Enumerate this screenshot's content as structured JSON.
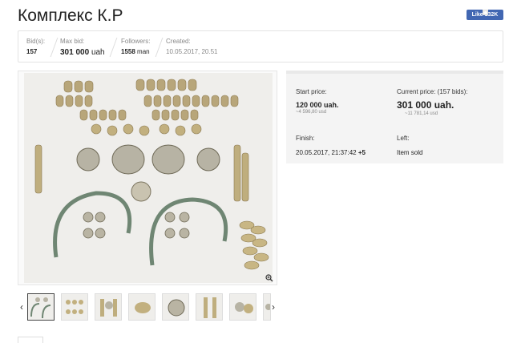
{
  "page": {
    "title": "Комплекс К.Р"
  },
  "like_button": {
    "label": "Like 132K",
    "color": "#4267b2"
  },
  "stats": {
    "bids_label": "Bid(s):",
    "bids_value": "157",
    "max_bid_label": "Max bid:",
    "max_bid_value": "301 000",
    "max_bid_currency": "uah",
    "followers_label": "Followers:",
    "followers_value": "1558",
    "followers_unit": "man",
    "created_label": "Created:",
    "created_value": "10.05.2017, 20.51"
  },
  "gallery": {
    "zoom_icon": "zoom-in-icon",
    "prev_icon": "chevron-left-icon",
    "next_icon": "chevron-right-icon",
    "thumbnail_count": 8,
    "active_thumbnail": 1
  },
  "auction": {
    "start_price_label": "Start price:",
    "start_price_value": "120 000 uah.",
    "start_price_usd": "~4 596,80 usd",
    "current_price_label": "Current price: (157 bids):",
    "current_price_value": "301 000 uah.",
    "current_price_usd": "~11 781,14 usd",
    "finish_label": "Finish:",
    "finish_date": "20.05.2017, 21:37:42",
    "finish_extra": "+5",
    "left_label": "Left:",
    "left_value": "Item sold"
  }
}
